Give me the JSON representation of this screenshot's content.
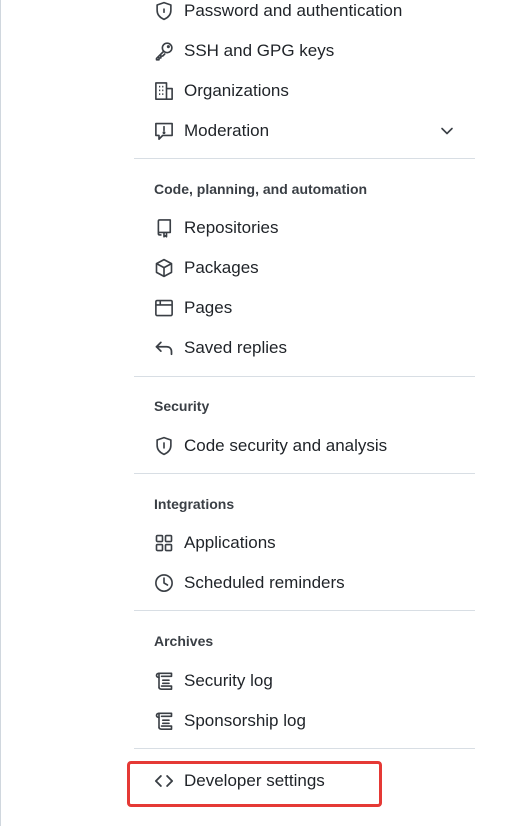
{
  "account_items": [
    {
      "label": "Password and authentication",
      "icon": "shield-lock-icon"
    },
    {
      "label": "SSH and GPG keys",
      "icon": "key-icon"
    },
    {
      "label": "Organizations",
      "icon": "organization-icon"
    },
    {
      "label": "Moderation",
      "icon": "report-icon",
      "expand_icon": "chevron-down-icon"
    }
  ],
  "sections": {
    "code": {
      "title": "Code, planning, and automation",
      "items": [
        {
          "label": "Repositories",
          "icon": "repo-icon"
        },
        {
          "label": "Packages",
          "icon": "package-icon"
        },
        {
          "label": "Pages",
          "icon": "browser-icon"
        },
        {
          "label": "Saved replies",
          "icon": "reply-icon"
        }
      ]
    },
    "security": {
      "title": "Security",
      "items": [
        {
          "label": "Code security and analysis",
          "icon": "shield-icon"
        }
      ]
    },
    "integrations": {
      "title": "Integrations",
      "items": [
        {
          "label": "Applications",
          "icon": "apps-icon"
        },
        {
          "label": "Scheduled reminders",
          "icon": "clock-icon"
        }
      ]
    },
    "archives": {
      "title": "Archives",
      "items": [
        {
          "label": "Security log",
          "icon": "log-icon"
        },
        {
          "label": "Sponsorship log",
          "icon": "log-icon"
        }
      ]
    }
  },
  "developer_settings": {
    "label": "Developer settings",
    "icon": "code-icon"
  },
  "colors": {
    "highlight_border": "#e53935",
    "divider": "#d8dee4",
    "text": "#1f2328",
    "muted": "#3a3f45"
  }
}
